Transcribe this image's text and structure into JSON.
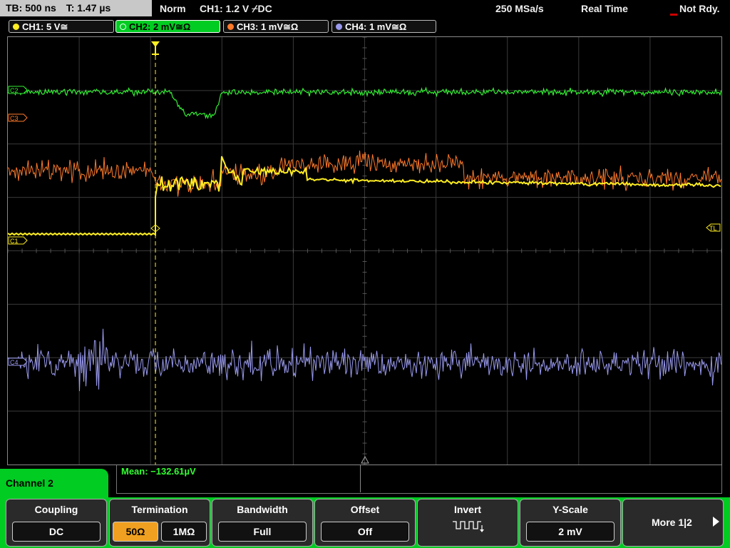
{
  "status": {
    "timebase": "TB: 500 ns",
    "trigger_time": "T: 1.47 µs",
    "trigger_mode": "Norm",
    "trigger_source": "CH1: 1.2 V ⌿DC",
    "sample_rate": "250 MSa/s",
    "acq_mode": "Real Time",
    "state": "Not Rdy."
  },
  "channels": [
    {
      "label": "CH1: 5 V≅",
      "color": "#ffee22"
    },
    {
      "label": "CH2: 2 mV≅Ω",
      "color": "#33ee33"
    },
    {
      "label": "CH3: 1 mV≅Ω",
      "color": "#ff7a2a"
    },
    {
      "label": "CH4: 1 mV≅Ω",
      "color": "#9999ee"
    }
  ],
  "markers": {
    "c2": "C2",
    "c3": "C3",
    "c1": "C1",
    "c4": "C4",
    "tl": "TL"
  },
  "measurement": "Mean: −132.61µV",
  "menu": {
    "title": "Channel 2",
    "coupling": {
      "title": "Coupling",
      "value": "DC"
    },
    "termination": {
      "title": "Termination",
      "options": [
        "50Ω",
        "1MΩ"
      ],
      "selected": "50Ω"
    },
    "bandwidth": {
      "title": "Bandwidth",
      "value": "Full"
    },
    "offset": {
      "title": "Offset",
      "value": "Off"
    },
    "invert": {
      "title": "Invert",
      "icon": "inverted-pulse-icon"
    },
    "yscale": {
      "title": "Y-Scale",
      "value": "2 mV"
    },
    "more": {
      "label": "More 1|2",
      "icon": "triangle-right-icon"
    }
  }
}
